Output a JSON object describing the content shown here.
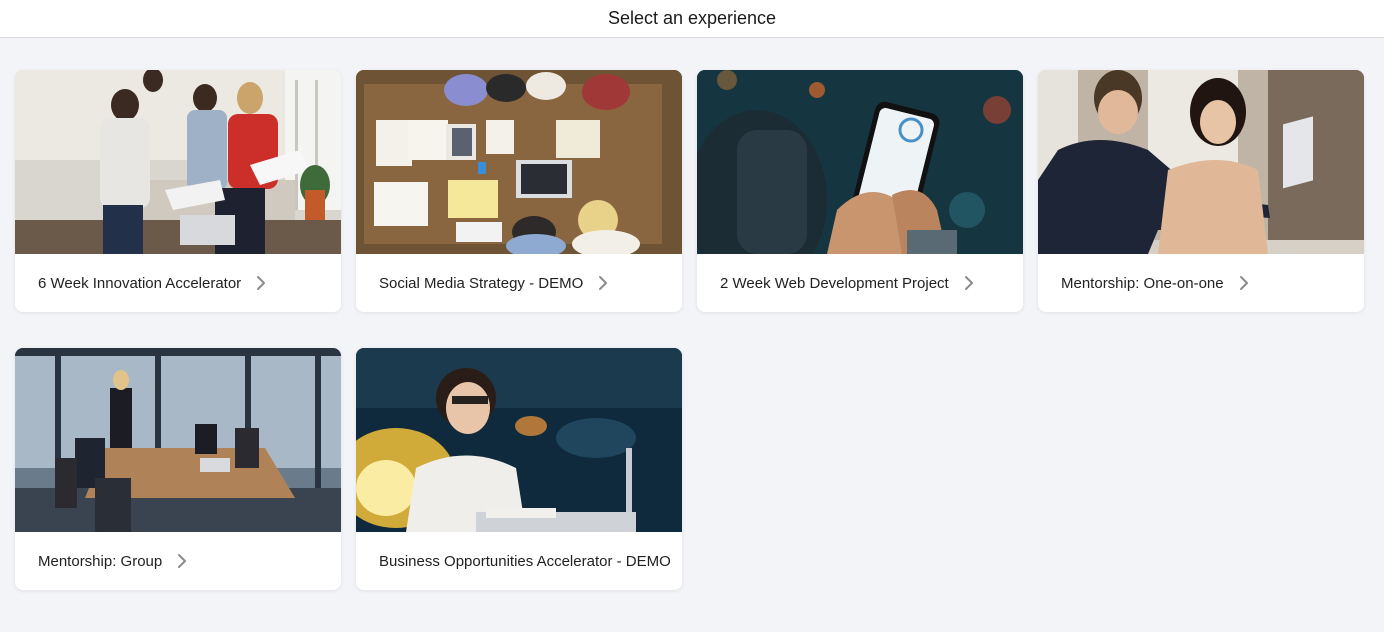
{
  "header": {
    "title": "Select an experience"
  },
  "cards": [
    {
      "title": "6 Week Innovation Accelerator",
      "image": "team-meeting-photo",
      "chevron": true
    },
    {
      "title": "Social Media Strategy - DEMO",
      "image": "overhead-desk-photo",
      "chevron": true
    },
    {
      "title": "2 Week Web Development Project",
      "image": "smartphone-app-photo",
      "chevron": true
    },
    {
      "title": "Mentorship: One-on-one",
      "image": "mentor-laptop-photo",
      "chevron": true
    },
    {
      "title": "Mentorship: Group",
      "image": "conference-room-photo",
      "chevron": true
    },
    {
      "title": "Business Opportunities Accelerator - DEMO",
      "image": "woman-glasses-office-photo",
      "chevron": false
    }
  ],
  "colors": {
    "page_bg": "#f3f4f8",
    "card_bg": "#ffffff",
    "chevron": "#8a8a8a"
  }
}
